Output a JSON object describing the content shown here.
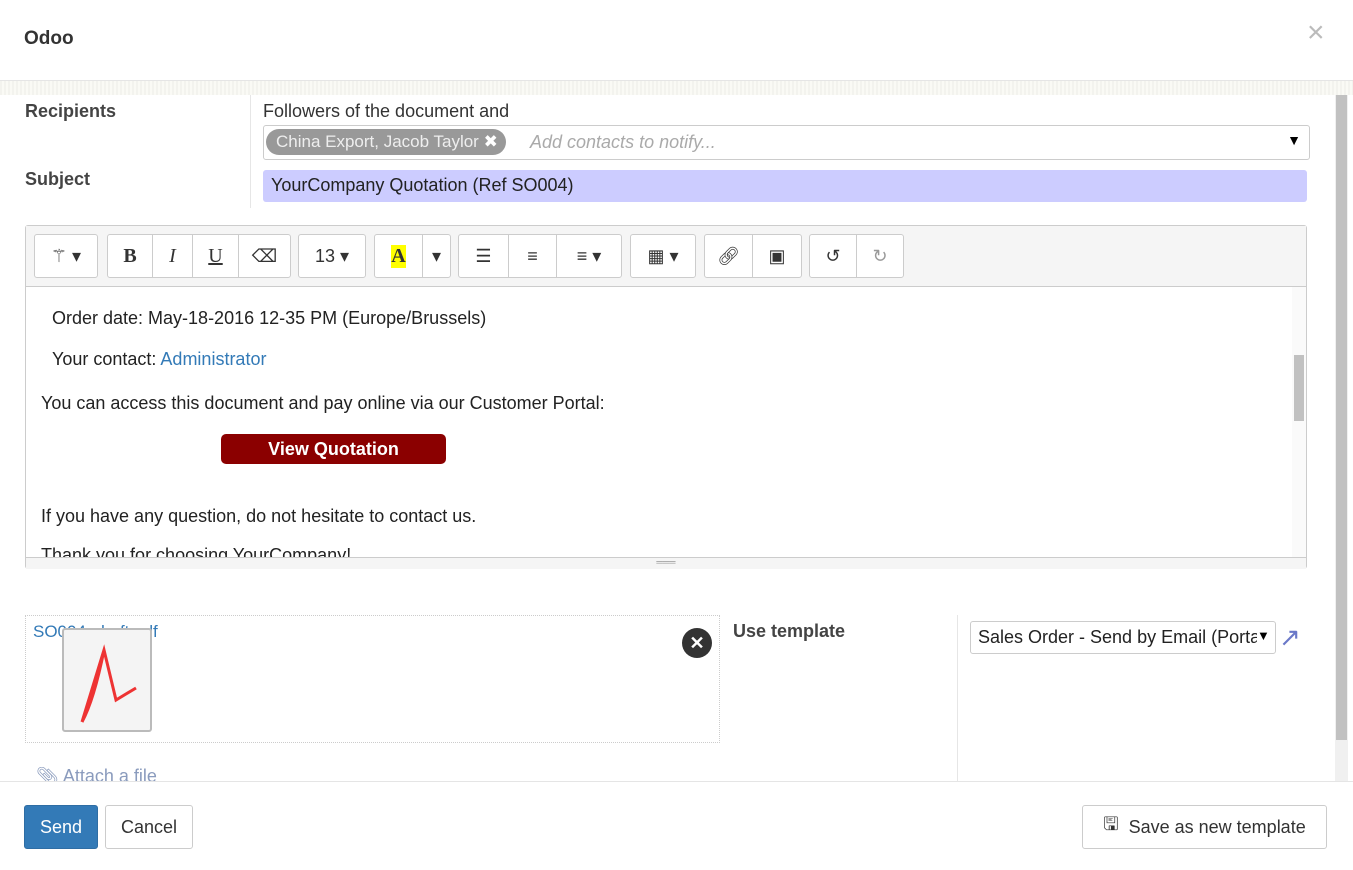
{
  "dialog": {
    "title": "Odoo",
    "close_icon": "close-icon"
  },
  "form": {
    "recipients_label": "Recipients",
    "recipients_prefix": "Followers of the document and",
    "recipients_tag": "China Export, Jacob Taylor",
    "recipients_placeholder": "Add contacts to notify...",
    "subject_label": "Subject",
    "subject_value": "YourCompany Quotation (Ref SO004)",
    "subject_bg": "#ccccff"
  },
  "toolbar": {
    "font_size": "13",
    "bold": "B",
    "italic": "I",
    "underline": "U",
    "highlight": "A"
  },
  "body": {
    "order_date": "Order date: May-18-2016 12-35 PM (Europe/Brussels)",
    "contact_prefix": "Your contact: ",
    "contact_link": "Administrator",
    "portal_text": "You can access this document and pay online via our Customer Portal:",
    "cta_label": "View Quotation",
    "cta_color": "#8b0000",
    "question_text": "If you have any question, do not hesitate to contact us.",
    "thanks_text": "Thank you for choosing YourCompany!"
  },
  "attachments": {
    "file_name": "SO004_draft.pdf",
    "attach_label": "Attach a file"
  },
  "template": {
    "label": "Use template",
    "selected": "Sales Order - Send by Email (Portal)"
  },
  "footer": {
    "send": "Send",
    "cancel": "Cancel",
    "save_template": "Save as new template",
    "primary_color": "#337ab7"
  }
}
